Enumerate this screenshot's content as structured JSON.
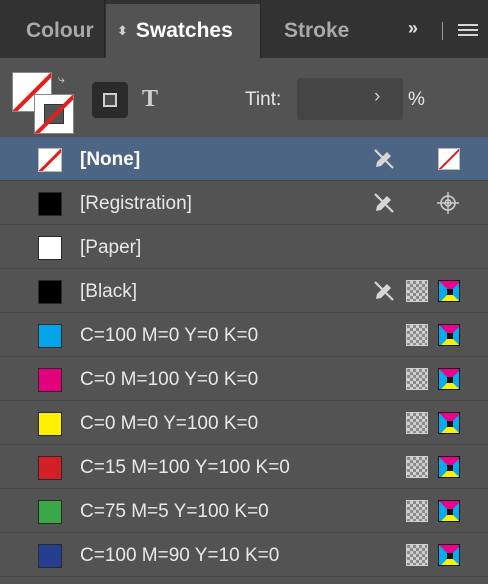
{
  "tabs": [
    {
      "label": "Colour",
      "active": false
    },
    {
      "label": "Swatches",
      "active": true
    },
    {
      "label": "Stroke",
      "active": false
    }
  ],
  "overflow_label": "››",
  "toolbar": {
    "tint_label": "Tint:",
    "tint_value": "",
    "tint_unit": "%",
    "text_mode_glyph": "T"
  },
  "swatches": [
    {
      "name": "[None]",
      "chip": "none",
      "selected": true,
      "no_edit": true,
      "process": false,
      "mode": "none"
    },
    {
      "name": "[Registration]",
      "chip": "#000000",
      "selected": false,
      "no_edit": true,
      "process": false,
      "mode": "registration"
    },
    {
      "name": "[Paper]",
      "chip": "#ffffff",
      "selected": false,
      "no_edit": false,
      "process": false,
      "mode": ""
    },
    {
      "name": "[Black]",
      "chip": "#000000",
      "selected": false,
      "no_edit": true,
      "process": true,
      "mode": "cmyk"
    },
    {
      "name": "C=100 M=0 Y=0 K=0",
      "chip": "#00a6e8",
      "selected": false,
      "no_edit": false,
      "process": true,
      "mode": "cmyk"
    },
    {
      "name": "C=0 M=100 Y=0 K=0",
      "chip": "#e3007a",
      "selected": false,
      "no_edit": false,
      "process": true,
      "mode": "cmyk"
    },
    {
      "name": "C=0 M=0 Y=100 K=0",
      "chip": "#fff000",
      "selected": false,
      "no_edit": false,
      "process": true,
      "mode": "cmyk"
    },
    {
      "name": "C=15 M=100 Y=100 K=0",
      "chip": "#d32027",
      "selected": false,
      "no_edit": false,
      "process": true,
      "mode": "cmyk"
    },
    {
      "name": "C=75 M=5 Y=100 K=0",
      "chip": "#3aa847",
      "selected": false,
      "no_edit": false,
      "process": true,
      "mode": "cmyk"
    },
    {
      "name": "C=100 M=90 Y=10 K=0",
      "chip": "#263e8f",
      "selected": false,
      "no_edit": false,
      "process": true,
      "mode": "cmyk"
    }
  ]
}
